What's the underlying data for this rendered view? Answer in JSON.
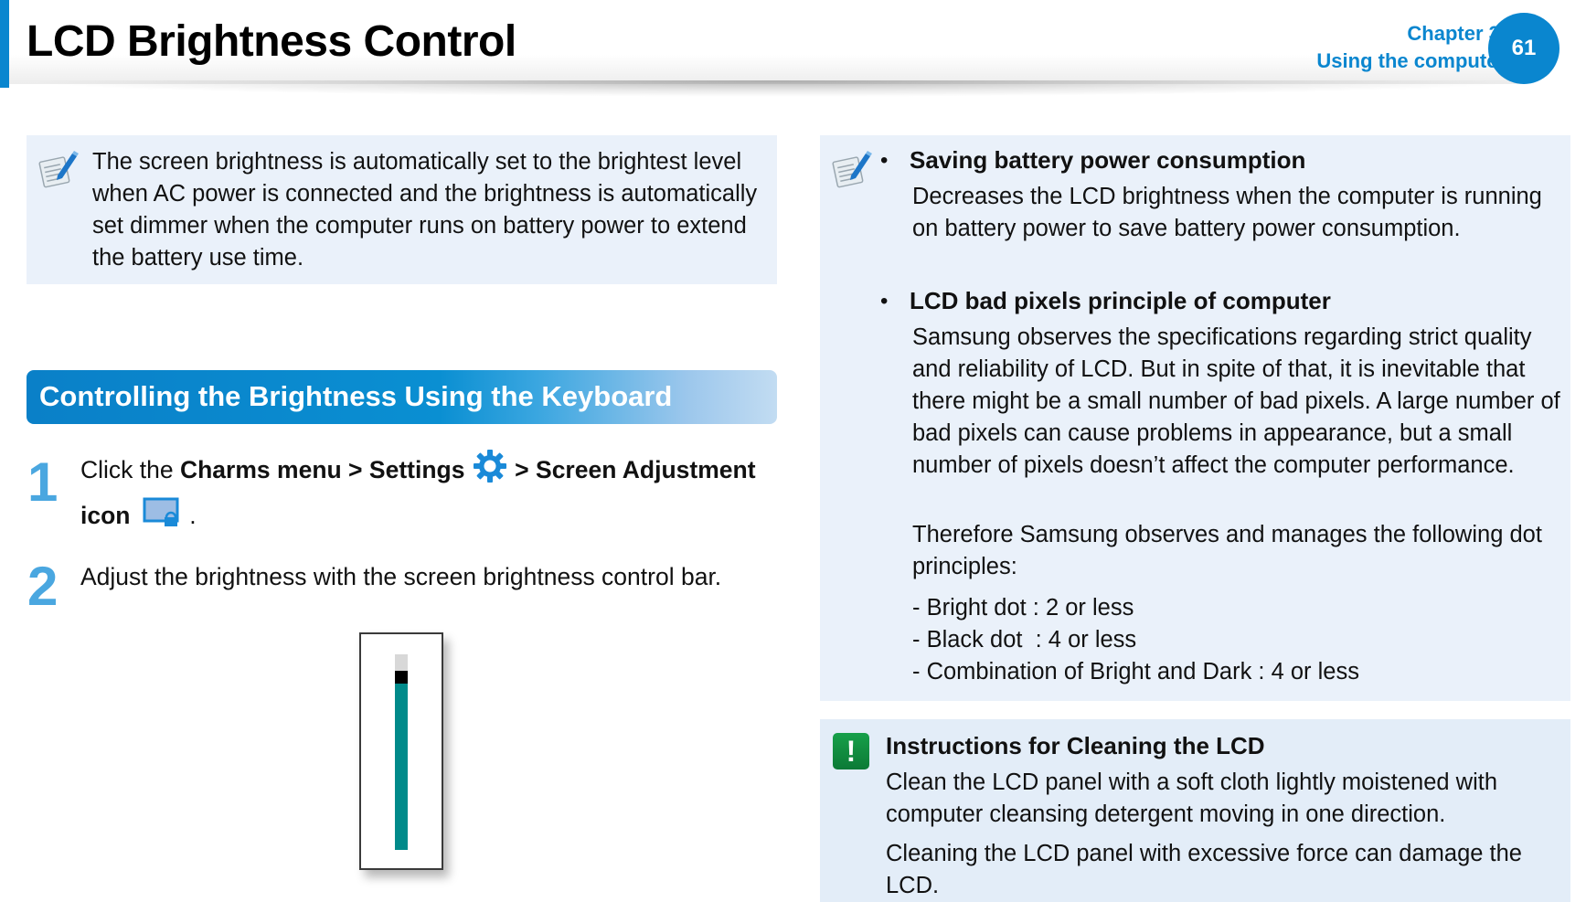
{
  "header": {
    "title": "LCD Brightness Control",
    "chapter_line1": "Chapter 3.",
    "chapter_line2": "Using the computer",
    "page_number": "61",
    "accent_color": "#0a86cf"
  },
  "left_note": {
    "icon": "note-pencil-icon",
    "text": "The screen brightness is automatically set to the brightest level when AC power is connected and the brightness is automatically set dimmer when the computer runs on battery power to extend the battery use time."
  },
  "section": {
    "title": "Controlling the Brightness Using the Keyboard"
  },
  "steps": [
    {
      "number": "1",
      "prefix": "Click the ",
      "bold1": "Charms menu > Settings",
      "icon1": "settings-gear-icon",
      "bold2": " > Screen Adjustment icon",
      "icon2": "screen-adjustment-icon",
      "suffix": " ."
    },
    {
      "number": "2",
      "text": "Adjust the brightness with the screen brightness control bar."
    }
  ],
  "brightness_slider": {
    "level_percent": 85,
    "fill_color": "#008a8a",
    "thumb_color": "#000000",
    "track_color": "#d8d8d8"
  },
  "right_note": {
    "icon": "note-pencil-icon",
    "bullets": [
      {
        "heading": "Saving battery power consumption",
        "paragraphs": [
          "Decreases the LCD brightness when the computer is running on battery power to save battery power consumption."
        ]
      },
      {
        "heading": "LCD bad pixels principle of computer",
        "paragraphs": [
          "Samsung observes the specifications regarding strict quality and reliability of LCD. But in spite of that, it is inevitable that there might be a small number of bad pixels. A large number of bad pixels can cause problems in appearance, but a small number of pixels doesn’t affect the computer performance.",
          "Therefore Samsung observes and manages the following dot principles:"
        ],
        "list": [
          "- Bright dot : 2 or less",
          "- Black dot  : 4 or less",
          "- Combination of Bright and Dark : 4 or less"
        ]
      }
    ]
  },
  "warning": {
    "icon": "warning-exclamation-icon",
    "title": "Instructions for Cleaning the LCD",
    "paragraphs": [
      "Clean the LCD panel with a soft cloth lightly moistened with computer cleansing detergent moving in one direction.",
      "Cleaning the LCD panel with excessive force can damage the LCD."
    ]
  }
}
